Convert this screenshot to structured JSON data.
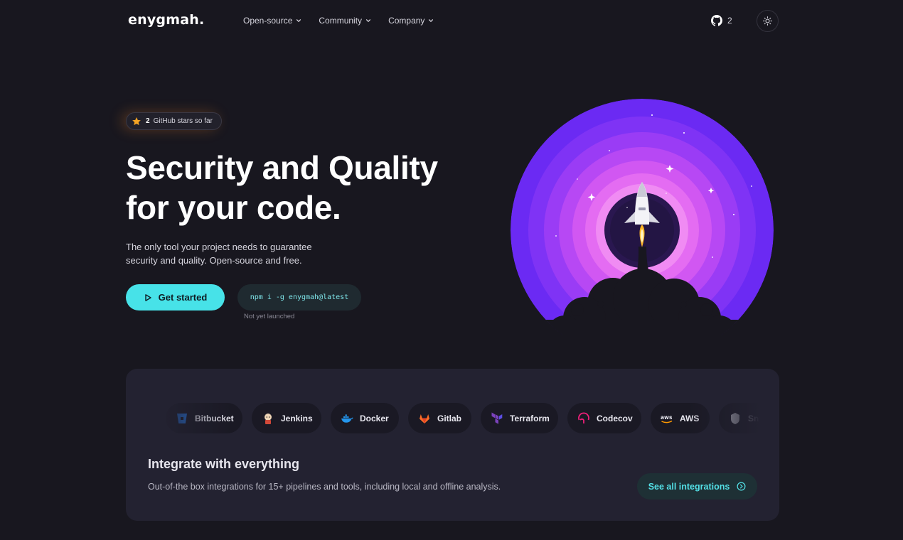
{
  "nav": {
    "logo": "enygmah.",
    "items": [
      {
        "label": "Open-source"
      },
      {
        "label": "Community"
      },
      {
        "label": "Company"
      }
    ],
    "github_count": "2",
    "icons": {
      "github": "github-icon",
      "theme": "sun-icon",
      "chevron": "chevron-down-icon"
    }
  },
  "hero": {
    "badge_count": "2",
    "badge_text": "GitHub stars so far",
    "title_line1": "Security and Quality",
    "title_line2": "for your code.",
    "subtitle": "The only tool your project needs to guarantee security and quality. Open-source and free.",
    "cta_label": "Get started",
    "npm_command": "npm i -g enygmah@latest",
    "npm_note": "Not yet launched"
  },
  "integrations": {
    "items": [
      {
        "label": "Bitbucket",
        "icon": "bitbucket-icon"
      },
      {
        "label": "Jenkins",
        "icon": "jenkins-icon"
      },
      {
        "label": "Docker",
        "icon": "docker-icon"
      },
      {
        "label": "Gitlab",
        "icon": "gitlab-icon"
      },
      {
        "label": "Terraform",
        "icon": "terraform-icon"
      },
      {
        "label": "Codecov",
        "icon": "codecov-icon"
      },
      {
        "label": "AWS",
        "icon": "aws-icon"
      },
      {
        "label": "Snyk",
        "icon": "snyk-icon"
      }
    ],
    "title": "Integrate with everything",
    "subtitle": "Out-of-the box integrations for 15+ pipelines and tools, including local and offline analysis.",
    "see_all_label": "See all integrations"
  },
  "colors": {
    "background": "#18171f",
    "accent": "#47e2e8",
    "card": "#232231",
    "purple": "#7b2ff7",
    "pink": "#e26bf0"
  }
}
